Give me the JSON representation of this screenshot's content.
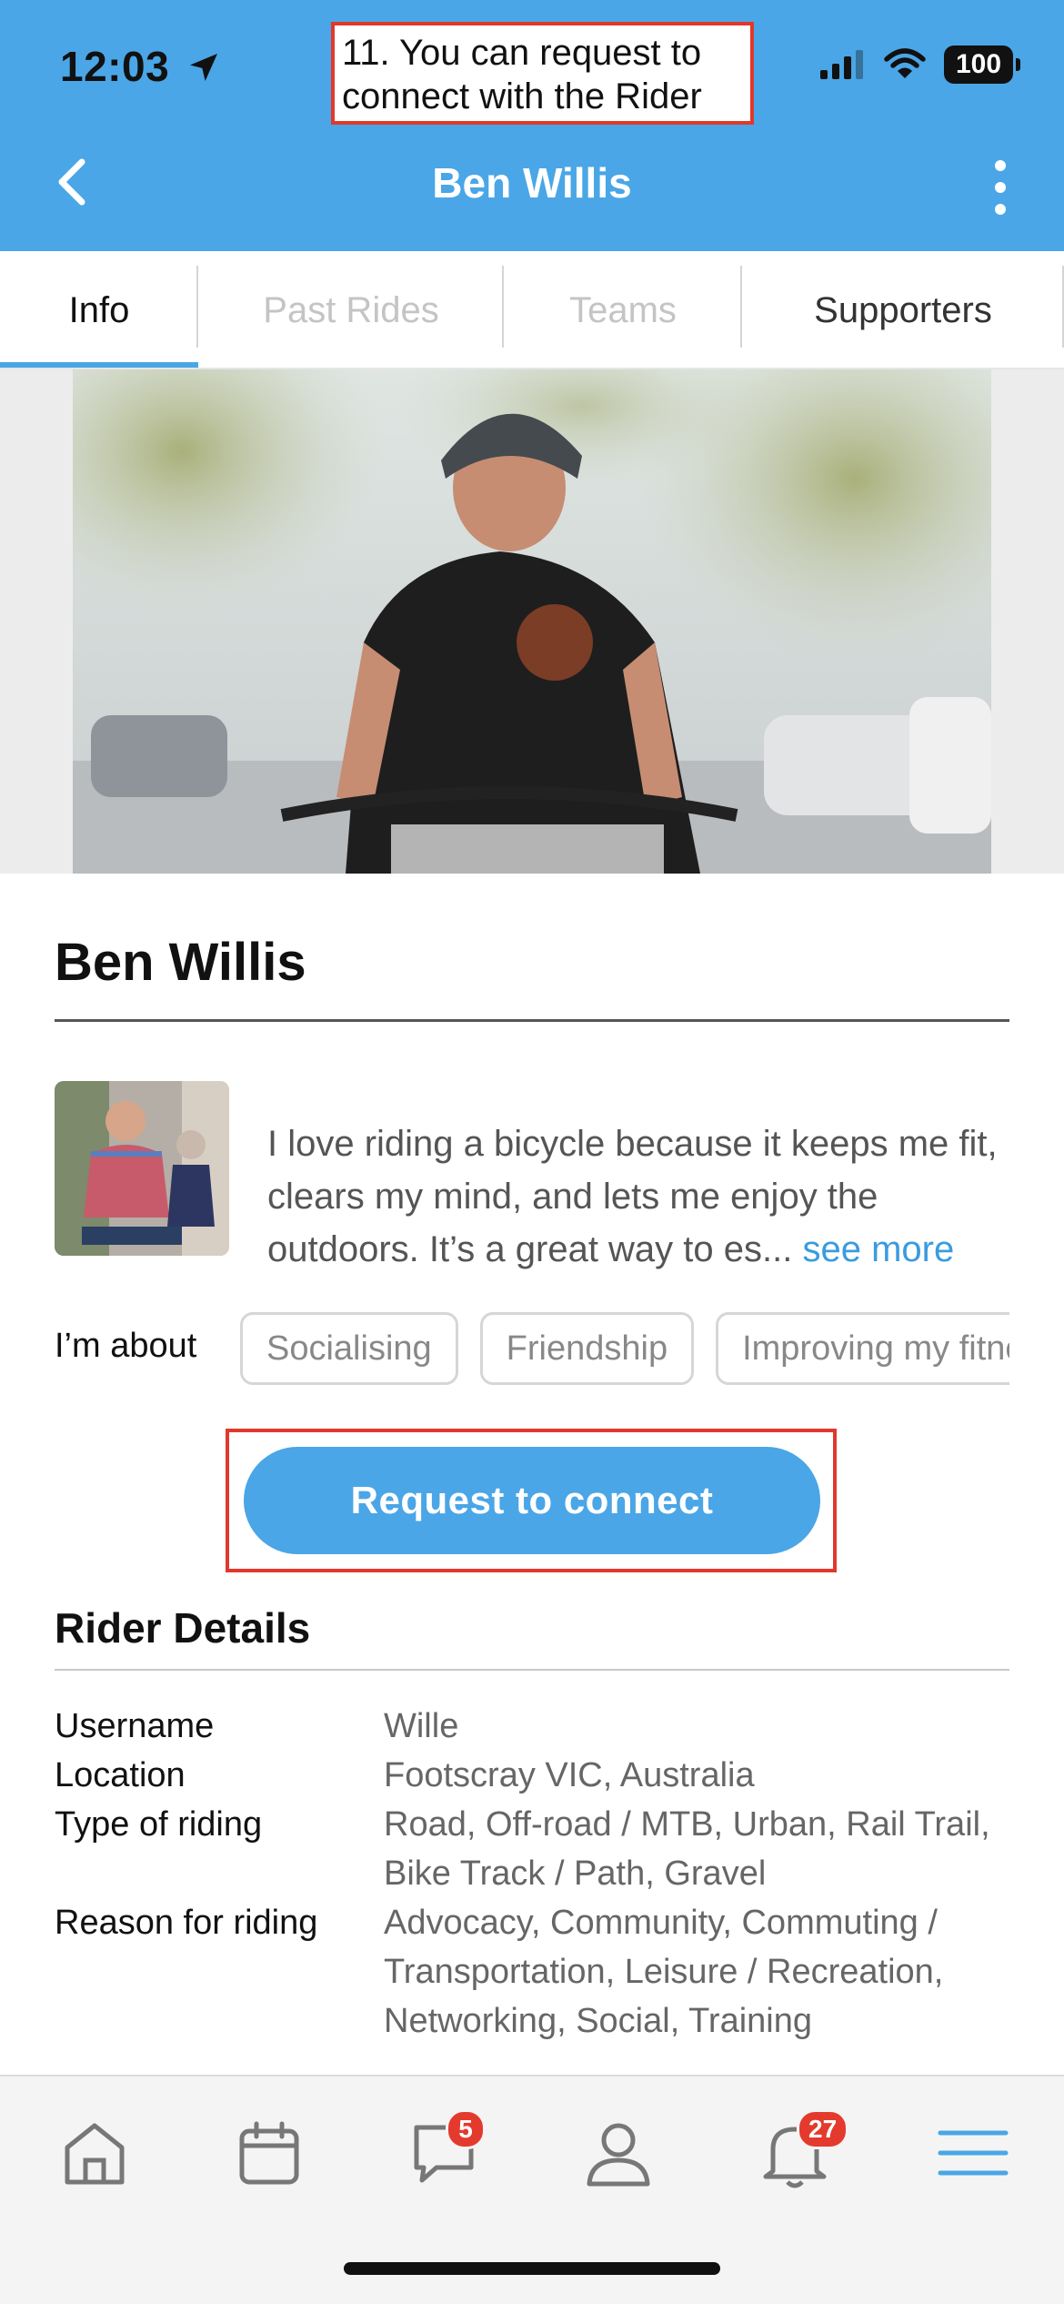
{
  "status_bar": {
    "time": "12:03",
    "battery": "100"
  },
  "annotation": {
    "note": "11. You can request to connect with the Rider"
  },
  "header": {
    "title": "Ben Willis"
  },
  "tabs": [
    {
      "label": "Info"
    },
    {
      "label": "Past Rides"
    },
    {
      "label": "Teams"
    },
    {
      "label": "Supporters"
    }
  ],
  "profile": {
    "name": "Ben Willis",
    "bio": "I love riding a bicycle because it keeps me fit, clears my mind, and lets me enjoy the outdoors. It’s a great way to es...",
    "see_more": "see more",
    "about_label": "I’m about",
    "chips": [
      "Socialising",
      "Friendship",
      "Improving my fitness"
    ],
    "cta_label": "Request to connect"
  },
  "rider_details": {
    "heading": "Rider Details",
    "rows": [
      {
        "key": "Username",
        "value": "Wille"
      },
      {
        "key": "Location",
        "value": "Footscray VIC, Australia"
      },
      {
        "key": "Type of riding",
        "value": "Road, Off-road / MTB, Urban, Rail Trail, Bike Track / Path, Gravel"
      },
      {
        "key": "Reason for riding",
        "value": "Advocacy, Community, Commuting / Transportation, Leisure / Recreation, Networking, Social, Training"
      }
    ]
  },
  "bottom_nav": {
    "items": [
      "home-icon",
      "calendar-icon",
      "chat-icon",
      "profile-icon",
      "bell-icon",
      "menu-icon"
    ],
    "messages_badge": "5",
    "notifications_badge": "27"
  },
  "colors": {
    "brand": "#4aa6e6",
    "annotation": "#e0382c",
    "badge": "#e43a2e"
  }
}
